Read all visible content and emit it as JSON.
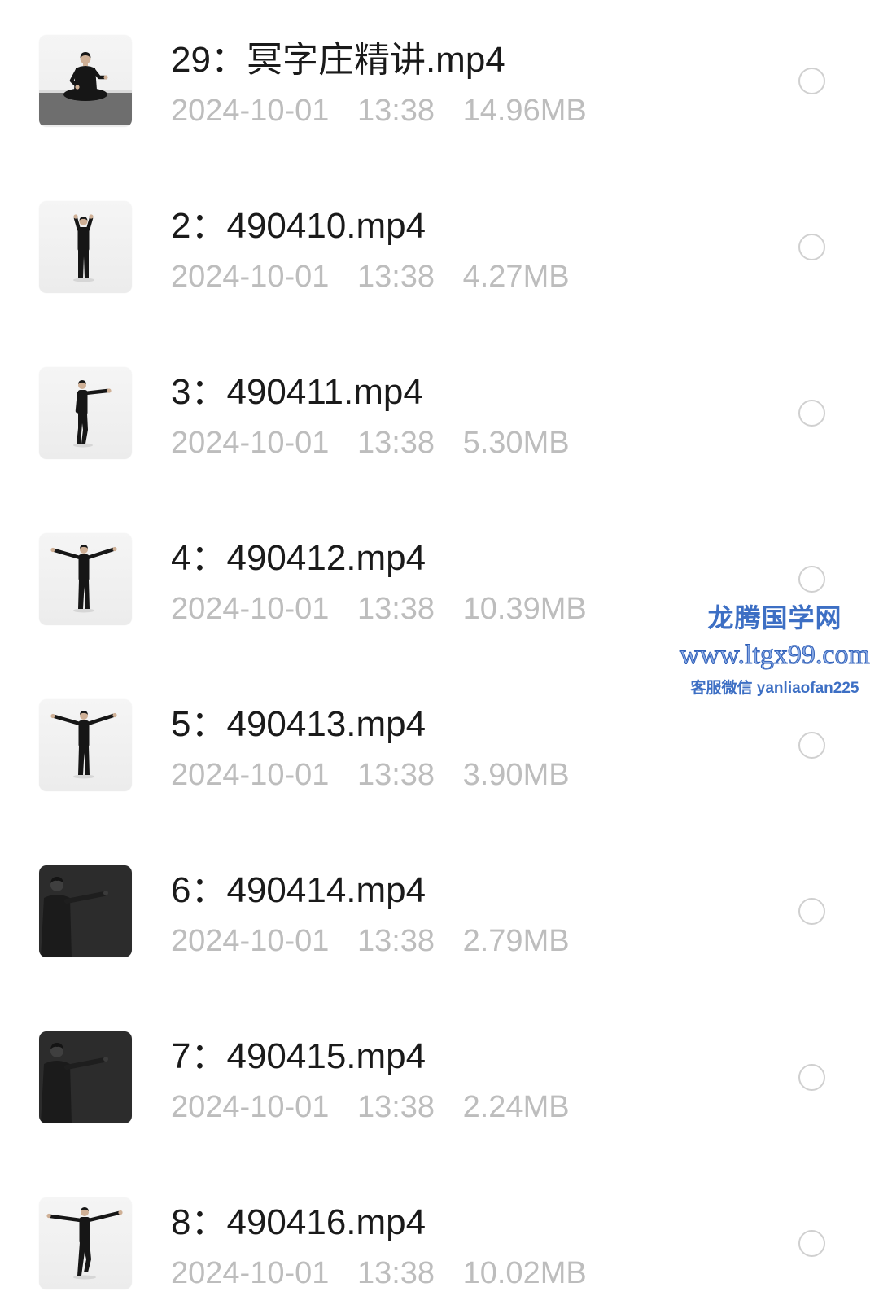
{
  "theme": {
    "background": "#ffffff",
    "title_color": "#1a1a1a",
    "meta_color": "#bdbdbd",
    "radio_border": "#d0d0d0",
    "watermark_color": "#3d6fc4"
  },
  "files": [
    {
      "name": "29：冥字庄精讲.mp4",
      "date": "2024-10-01",
      "time": "13:38",
      "size": "14.96MB",
      "selected": false
    },
    {
      "name": "2：490410.mp4",
      "date": "2024-10-01",
      "time": "13:38",
      "size": "4.27MB",
      "selected": false
    },
    {
      "name": "3：490411.mp4",
      "date": "2024-10-01",
      "time": "13:38",
      "size": "5.30MB",
      "selected": false
    },
    {
      "name": "4：490412.mp4",
      "date": "2024-10-01",
      "time": "13:38",
      "size": "10.39MB",
      "selected": false
    },
    {
      "name": "5：490413.mp4",
      "date": "2024-10-01",
      "time": "13:38",
      "size": "3.90MB",
      "selected": false
    },
    {
      "name": "6：490414.mp4",
      "date": "2024-10-01",
      "time": "13:38",
      "size": "2.79MB",
      "selected": false
    },
    {
      "name": "7：490415.mp4",
      "date": "2024-10-01",
      "time": "13:38",
      "size": "2.24MB",
      "selected": false
    },
    {
      "name": "8：490416.mp4",
      "date": "2024-10-01",
      "time": "13:38",
      "size": "10.02MB",
      "selected": false
    }
  ],
  "watermark": {
    "site_name": "龙腾国学网",
    "url": "www.ltgx99.com",
    "contact": "客服微信 yanliaofan225"
  }
}
